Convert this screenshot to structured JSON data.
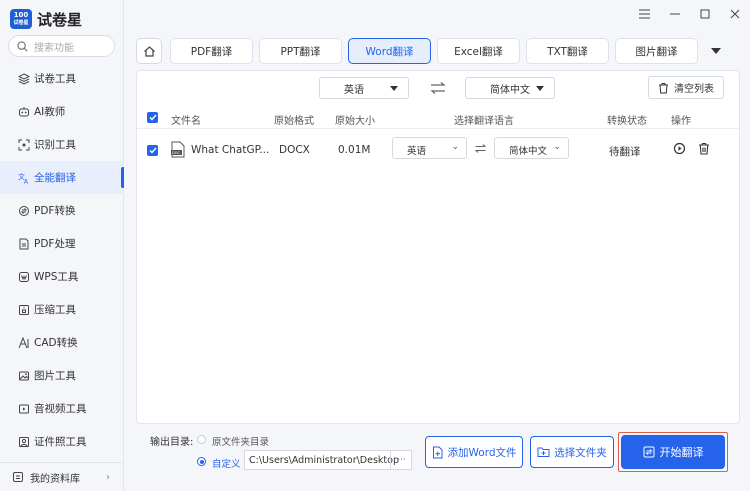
{
  "app": {
    "logo_badge_top": "100",
    "logo_badge_bottom": "试卷星",
    "name": "试卷星"
  },
  "search": {
    "placeholder": "搜索功能"
  },
  "sidebar": {
    "items": [
      {
        "label": "试卷工具",
        "icon": "layers-icon"
      },
      {
        "label": "AI教师",
        "icon": "robot-icon"
      },
      {
        "label": "识别工具",
        "icon": "scan-icon"
      },
      {
        "label": "全能翻译",
        "icon": "translate-icon",
        "active": true
      },
      {
        "label": "PDF转换",
        "icon": "convert-icon"
      },
      {
        "label": "PDF处理",
        "icon": "pdf-file-icon"
      },
      {
        "label": "WPS工具",
        "icon": "wps-icon"
      },
      {
        "label": "压缩工具",
        "icon": "compress-icon"
      },
      {
        "label": "CAD转换",
        "icon": "cad-icon"
      },
      {
        "label": "图片工具",
        "icon": "image-icon"
      },
      {
        "label": "音视频工具",
        "icon": "media-icon"
      },
      {
        "label": "证件照工具",
        "icon": "id-photo-icon"
      }
    ],
    "library_label": "我的资料库"
  },
  "tabs": [
    "PDF翻译",
    "PPT翻译",
    "Word翻译",
    "Excel翻译",
    "TXT翻译",
    "图片翻译"
  ],
  "active_tab": "Word翻译",
  "toolbar": {
    "source_lang": "英语",
    "target_lang": "简体中文",
    "clear_label": "清空列表"
  },
  "table": {
    "headers": [
      "文件名",
      "原始格式",
      "原始大小",
      "选择翻译语言",
      "转换状态",
      "操作"
    ],
    "rows": [
      {
        "filename": "What ChatGP...",
        "format": "DOCX",
        "size": "0.01M",
        "src": "英语",
        "dst": "简体中文",
        "status": "待翻译"
      }
    ]
  },
  "bottom": {
    "output_label": "输出目录:",
    "option_original": "原文件夹目录",
    "option_custom": "自定义",
    "path": "C:\\Users\\Administrator\\Desktop",
    "browse": "···",
    "add_label": "添加Word文件",
    "folder_label": "选择文件夹",
    "start_label": "开始翻译"
  },
  "colors": {
    "accent": "#2563eb",
    "highlight": "#e06050"
  }
}
